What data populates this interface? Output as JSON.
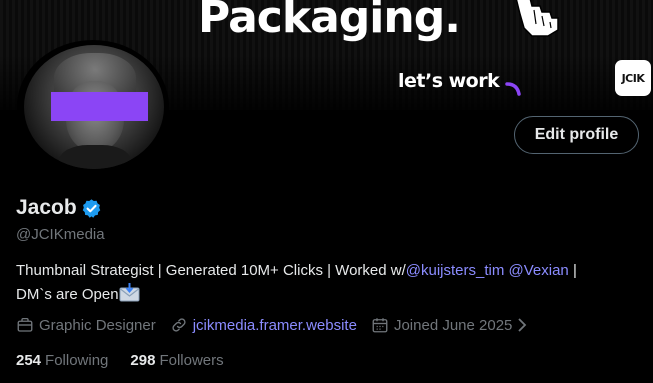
{
  "banner": {
    "headline": "Packaging.",
    "subline": "let’s work",
    "logo_text": "JCIK",
    "cursor_icon": "pointer-hand-icon"
  },
  "profile": {
    "name": "Jacob",
    "handle": "@JCIKmedia",
    "verified_icon": "verified-badge-icon",
    "edit_label": "Edit profile",
    "bio": {
      "text_before": "Thumbnail Strategist | Generated 10M+ Clicks | Worked w/",
      "mention_1": "@kuijsters_tim",
      "space": " ",
      "mention_2": "@Vexian",
      "text_after": " |",
      "line2": "DM`s are Open",
      "emoji_icon": "envelope-arrow-icon"
    },
    "meta": {
      "category": "Graphic Designer",
      "website": "jcikmedia.framer.website",
      "joined": "Joined June 2025"
    },
    "stats": {
      "following_count": "254",
      "following_label": "Following",
      "followers_count": "298",
      "followers_label": "Followers"
    }
  },
  "colors": {
    "background": "#000000",
    "text": "#e7e9ea",
    "muted": "#71767b",
    "link": "#8b8cff",
    "verified": "#1d9bf0",
    "accent_bar": "#8b45f5"
  }
}
